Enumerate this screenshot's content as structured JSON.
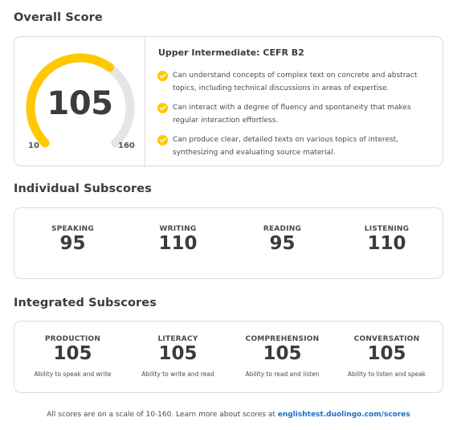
{
  "overall": {
    "title": "Overall Score",
    "score": "105",
    "min_label": "10",
    "max_label": "160",
    "score_value": 105,
    "scale_min": 10,
    "scale_max": 160,
    "level": "Upper Intermediate: CEFR B2",
    "descriptors": [
      "Can understand concepts of complex text on concrete and abstract topics, including technical discussions in areas of expertise.",
      "Can interact with a degree of fluency and spontaneity that makes regular interaction effortless.",
      "Can produce clear, detailed texts on various topics of interest, synthesizing and evaluating source material."
    ]
  },
  "individual": {
    "title": "Individual Subscores",
    "items": [
      {
        "label": "SPEAKING",
        "value": "95"
      },
      {
        "label": "WRITING",
        "value": "110"
      },
      {
        "label": "READING",
        "value": "95"
      },
      {
        "label": "LISTENING",
        "value": "110"
      }
    ]
  },
  "integrated": {
    "title": "Integrated Subscores",
    "items": [
      {
        "label": "PRODUCTION",
        "value": "105",
        "caption": "Ability to speak and write"
      },
      {
        "label": "LITERACY",
        "value": "105",
        "caption": "Ability to write and read"
      },
      {
        "label": "COMPREHENSION",
        "value": "105",
        "caption": "Ability to read and listen"
      },
      {
        "label": "CONVERSATION",
        "value": "105",
        "caption": "Ability to listen and speak"
      }
    ]
  },
  "footer": {
    "text": "All scores are on a scale of 10-160. Learn more about scores at",
    "link": "englishtest.duolingo.com/scores"
  },
  "colors": {
    "accent": "#ffc800",
    "track": "#e5e5e5",
    "link": "#1a6fc4"
  }
}
